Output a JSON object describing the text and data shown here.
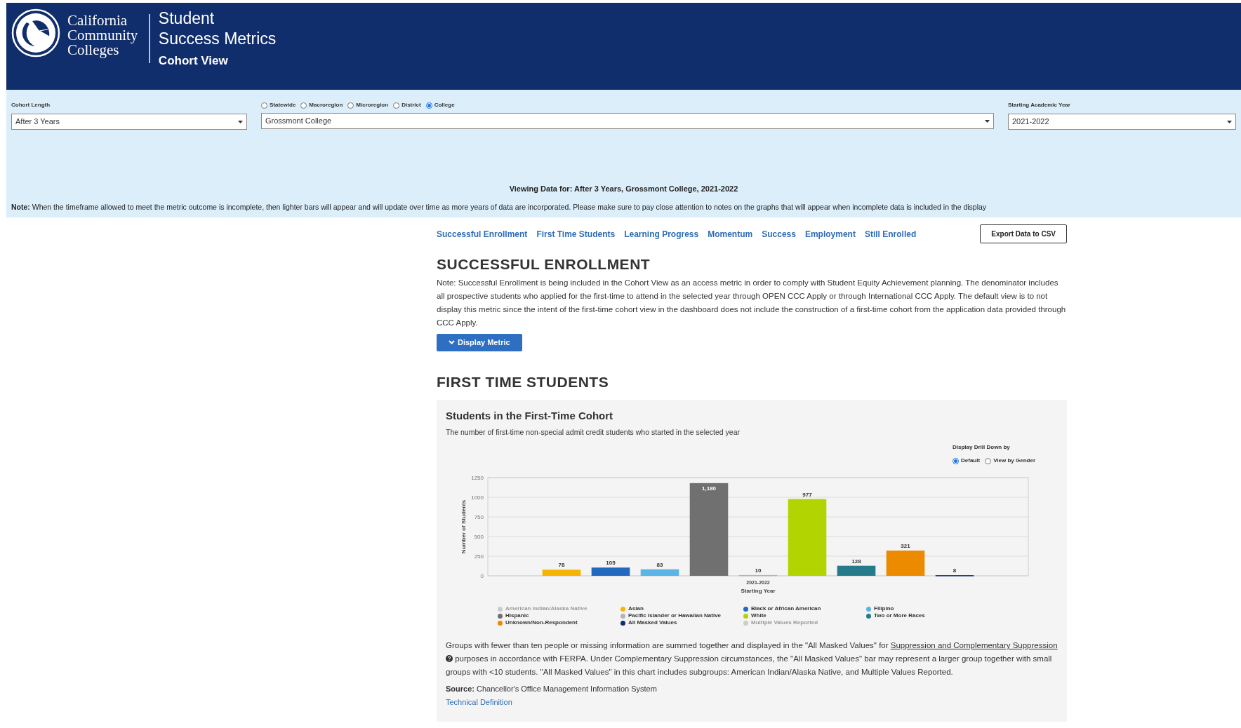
{
  "header": {
    "logo_lines": [
      "California",
      "Community",
      "Colleges"
    ],
    "title_lines": [
      "Student",
      "Success Metrics"
    ],
    "subtitle": "Cohort View"
  },
  "filters": {
    "cohort_length": {
      "label": "Cohort Length",
      "value": "After 3 Years"
    },
    "levels": [
      {
        "label": "Statewide",
        "selected": false
      },
      {
        "label": "Macroregion",
        "selected": false
      },
      {
        "label": "Microregion",
        "selected": false
      },
      {
        "label": "District",
        "selected": false
      },
      {
        "label": "College",
        "selected": true
      }
    ],
    "location": {
      "value": "Grossmont College"
    },
    "starting_year": {
      "label": "Starting Academic Year",
      "value": "2021-2022"
    }
  },
  "viewing": "Viewing Data for: After 3 Years, Grossmont College, 2021-2022",
  "note": {
    "label": "Note:",
    "text": "When the timeframe allowed to meet the metric outcome is incomplete, then lighter bars will appear and will update over time as more years of data are incorporated. Please make sure to pay close attention to notes on the graphs that will appear when incomplete data is included in the display"
  },
  "nav_links": [
    "Successful Enrollment",
    "First Time Students",
    "Learning Progress",
    "Momentum",
    "Success",
    "Employment",
    "Still Enrolled"
  ],
  "export_button": "Export Data to CSV",
  "successful_enrollment": {
    "heading": "SUCCESSFUL ENROLLMENT",
    "note": "Note: Successful Enrollment is being included in the Cohort View as an access metric in order to comply with Student Equity Achievement planning. The denominator includes all prospective students who applied for the first-time to attend in the selected year through OPEN CCC Apply or through International CCC Apply. The default view is to not display this metric since the intent of the first-time cohort view in the dashboard does not include the construction of a first-time cohort from the application data provided through CCC Apply.",
    "button": "Display Metric"
  },
  "first_time_students": {
    "heading": "FIRST TIME STUDENTS",
    "card": {
      "title": "Students in the First-Time Cohort",
      "subtitle": "The number of first-time non-special admit credit students who started in the selected year",
      "drill_down": {
        "label": "Display Drill Down by",
        "options": [
          {
            "label": "Default",
            "selected": true
          },
          {
            "label": "View by Gender",
            "selected": false
          }
        ]
      },
      "chart_data": {
        "type": "bar",
        "xlabel": "Starting Year",
        "ylabel": "Number of Students",
        "categories": [
          "2021-2022"
        ],
        "ylim": [
          0,
          1250
        ],
        "yticks": [
          0,
          250,
          500,
          750,
          1000,
          1250
        ],
        "grid": true,
        "data_labels": true,
        "series": [
          {
            "name": "American Indian/Alaska Native",
            "color": "#cccccc",
            "values": [
              null
            ]
          },
          {
            "name": "Asian",
            "color": "#f5b400",
            "values": [
              78
            ],
            "value_labels": [
              "78"
            ]
          },
          {
            "name": "Black or African American",
            "color": "#2469c0",
            "values": [
              105
            ],
            "value_labels": [
              "105"
            ]
          },
          {
            "name": "Filipino",
            "color": "#5ab4e6",
            "values": [
              83
            ],
            "value_labels": [
              "83"
            ]
          },
          {
            "name": "Hispanic",
            "color": "#707070",
            "values": [
              1180
            ],
            "value_labels": [
              "1,180"
            ]
          },
          {
            "name": "Pacific Islander or Hawaiian Native",
            "color": "#b4b4b4",
            "values": [
              10
            ],
            "value_labels": [
              "10"
            ]
          },
          {
            "name": "White",
            "color": "#b2d400",
            "values": [
              977
            ],
            "value_labels": [
              "977"
            ]
          },
          {
            "name": "Two or More Races",
            "color": "#267b8a",
            "values": [
              128
            ],
            "value_labels": [
              "128"
            ]
          },
          {
            "name": "Unknown/Non-Respondent",
            "color": "#ec8a00",
            "values": [
              321
            ],
            "value_labels": [
              "321"
            ]
          },
          {
            "name": "All Masked Values",
            "color": "#122d6b",
            "values": [
              8
            ],
            "value_labels": [
              "8"
            ]
          },
          {
            "name": "Multiple Values Reported",
            "color": "#cccccc",
            "values": [
              null
            ]
          }
        ]
      },
      "footnote": {
        "before": "Groups with fewer than ten people or missing information are summed together and displayed in the \"All Masked Values\" for",
        "link": "Suppression and Complementary Suppression",
        "after": "purposes in accordance with FERPA. Under Complementary Suppression circumstances, the \"All Masked Values\" bar may represent a larger group together with small groups with <10 students. \"All Masked Values\" in this chart includes subgroups: American Indian/Alaska Native, and Multiple Values Reported."
      },
      "source": "**Source:** Chancellor's Office Management Information System",
      "technical_definition": "Technical Definition"
    }
  }
}
